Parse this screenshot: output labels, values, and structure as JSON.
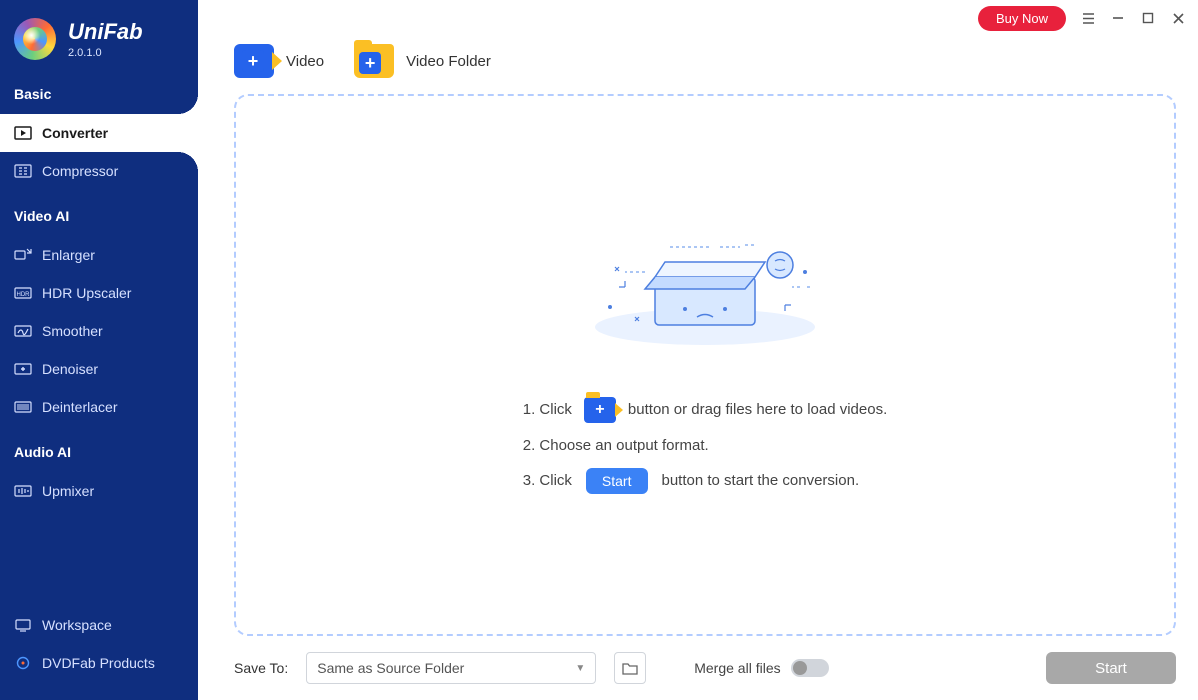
{
  "brand": {
    "name": "UniFab",
    "version": "2.0.1.0"
  },
  "sidebar": {
    "sections": [
      {
        "title": "Basic",
        "items": [
          {
            "label": "Converter",
            "icon": "converter-icon",
            "active": true
          },
          {
            "label": "Compressor",
            "icon": "compressor-icon"
          }
        ]
      },
      {
        "title": "Video AI",
        "items": [
          {
            "label": "Enlarger",
            "icon": "enlarger-icon"
          },
          {
            "label": "HDR Upscaler",
            "icon": "hdr-icon"
          },
          {
            "label": "Smoother",
            "icon": "smoother-icon"
          },
          {
            "label": "Denoiser",
            "icon": "denoiser-icon"
          },
          {
            "label": "Deinterlacer",
            "icon": "deinterlacer-icon"
          }
        ]
      },
      {
        "title": "Audio AI",
        "items": [
          {
            "label": "Upmixer",
            "icon": "upmixer-icon"
          }
        ]
      }
    ],
    "bottom": [
      {
        "label": "Workspace",
        "icon": "workspace-icon"
      },
      {
        "label": "DVDFab Products",
        "icon": "dvdfab-icon"
      }
    ]
  },
  "titlebar": {
    "buy": "Buy Now"
  },
  "toolbar": {
    "video": "Video",
    "folder": "Video Folder"
  },
  "instructions": {
    "line1a": "1. Click",
    "line1b": "button or drag files here to load videos.",
    "line2": "2. Choose an output format.",
    "line3a": "3. Click",
    "line3b": "button to start the conversion.",
    "mini_start": "Start"
  },
  "footer": {
    "save_label": "Save To:",
    "save_value": "Same as Source Folder",
    "merge_label": "Merge all files",
    "start": "Start"
  }
}
